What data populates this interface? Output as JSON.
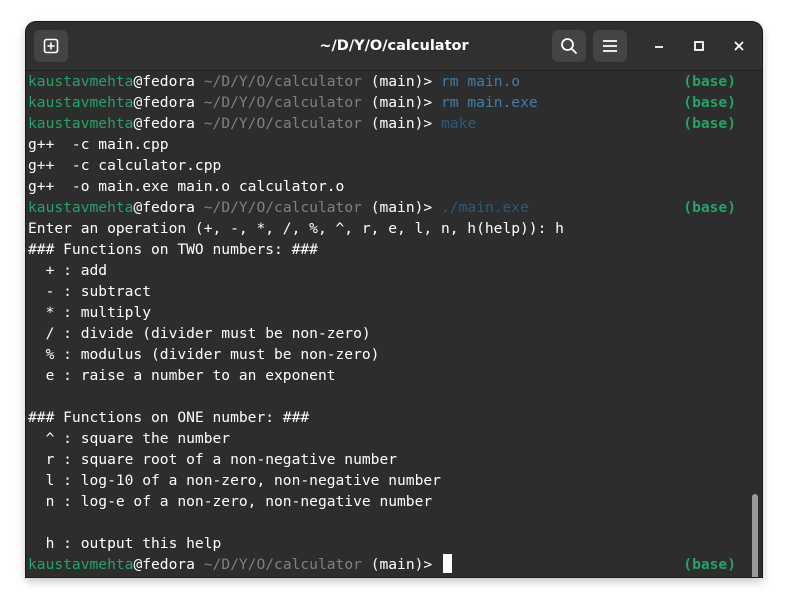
{
  "window": {
    "title": "~/D/Y/O/calculator",
    "new_tab_icon": "new-tab-icon",
    "search_icon": "search-icon",
    "menu_icon": "hamburger-menu-icon"
  },
  "prompt": {
    "user": "kaustavmehta",
    "at": "@",
    "host": "fedora",
    "path": "~/D/Y/O/calculator",
    "branch": "(main)>",
    "env": "(base)"
  },
  "lines": {
    "cmd1": "rm main.o",
    "cmd2": "rm main.exe",
    "cmd3": "make",
    "out1": "g++  -c main.cpp",
    "out2": "g++  -c calculator.cpp",
    "out3": "g++  -o main.exe main.o calculator.o",
    "cmd4": "./main.exe",
    "out4": "Enter an operation (+, -, *, /, %, ^, r, e, l, n, h(help)): h",
    "out5": "### Functions on TWO numbers: ###",
    "out6": "  + : add",
    "out7": "  - : subtract",
    "out8": "  * : multiply",
    "out9": "  / : divide (divider must be non-zero)",
    "out10": "  % : modulus (divider must be non-zero)",
    "out11": "  e : raise a number to an exponent",
    "out12": "### Functions on ONE number: ###",
    "out13": "  ^ : square the number",
    "out14": "  r : square root of a non-negative number",
    "out15": "  l : log-10 of a non-zero, non-negative number",
    "out16": "  n : log-e of a non-zero, non-negative number",
    "out17": "  h : output this help"
  },
  "colors": {
    "user": "#26a269",
    "command": "#3f7ea6",
    "env": "#26a269",
    "background": "#2d2d2d"
  }
}
